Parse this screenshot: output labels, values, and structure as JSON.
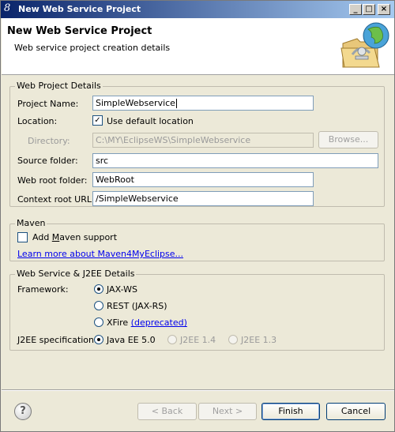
{
  "window": {
    "title": "New Web Service Project",
    "icon": "eclipse-icon",
    "controls": {
      "minimize": "_",
      "maximize": "□",
      "close": "×"
    }
  },
  "banner": {
    "title": "New Web Service Project",
    "subtitle": "Web service project creation details",
    "graphic": "web-service-wizard-graphic"
  },
  "web_project": {
    "legend": "Web Project Details",
    "project_name_label": "Project Name:",
    "project_name_value": "SimpleWebservice",
    "location_label": "Location:",
    "use_default_location_label": "Use default location",
    "use_default_location_checked": true,
    "directory_label": "Directory:",
    "directory_value": "C:\\MY\\EclipseWS\\SimpleWebservice",
    "browse_label": "Browse...",
    "source_folder_label": "Source folder:",
    "source_folder_value": "src",
    "web_root_label": "Web root folder:",
    "web_root_value": "WebRoot",
    "context_root_label": "Context root URL:",
    "context_root_value": "/SimpleWebservice"
  },
  "maven": {
    "legend": "Maven",
    "add_support_prefix": "Add ",
    "add_support_underlined": "M",
    "add_support_suffix": "aven support",
    "add_support_checked": false,
    "learn_more_link": "Learn more about Maven4MyEclipse..."
  },
  "ws_details": {
    "legend": "Web Service & J2EE Details",
    "framework_label": "Framework:",
    "frameworks": [
      {
        "label": "JAX-WS",
        "selected": true
      },
      {
        "label": "REST (JAX-RS)",
        "selected": false
      },
      {
        "label": "XFire",
        "selected": false
      }
    ],
    "xfire_note": "(deprecated)",
    "j2ee_label": "J2EE specification:",
    "j2ee_options": [
      {
        "label": "Java EE 5.0",
        "selected": true,
        "enabled": true
      },
      {
        "label": "J2EE 1.4",
        "selected": false,
        "enabled": false
      },
      {
        "label": "J2EE 1.3",
        "selected": false,
        "enabled": false
      }
    ]
  },
  "footer": {
    "help_icon": "help-icon",
    "help_glyph": "?",
    "back_label": "< Back",
    "next_label": "Next >",
    "finish_label": "Finish",
    "cancel_label": "Cancel"
  }
}
